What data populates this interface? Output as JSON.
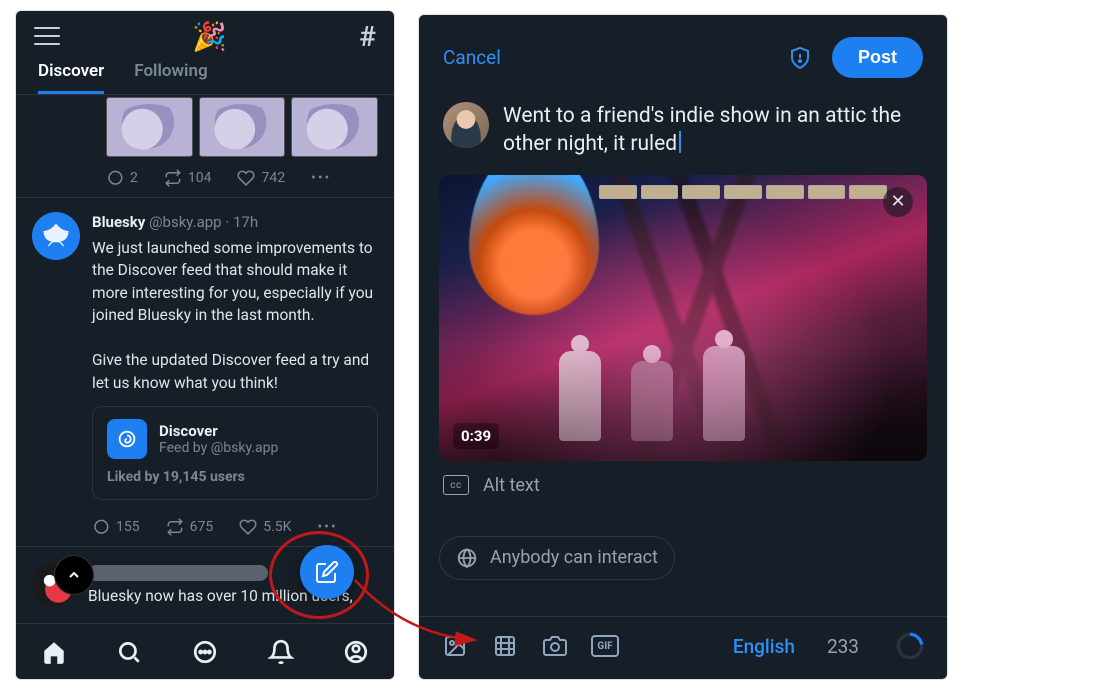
{
  "left": {
    "tabs": {
      "discover": "Discover",
      "following": "Following"
    },
    "first_actions": {
      "replies": "2",
      "reposts": "104",
      "likes": "742"
    },
    "bsky_post": {
      "display_name": "Bluesky",
      "handle": "@bsky.app",
      "time": "17h",
      "body_1": "We just launched some improvements to the Discover feed that should make it more interesting for you, especially if you joined Bluesky in the last month.",
      "body_2": "Give the updated Discover feed a try and let us know what you think!",
      "feed_card": {
        "title": "Discover",
        "subtitle": "Feed by @bsky.app",
        "likes": "Liked by 19,145 users"
      },
      "actions": {
        "replies": "155",
        "reposts": "675",
        "likes": "5.5K"
      }
    },
    "next_post_text": "Bluesky now has over 10 million users,"
  },
  "right": {
    "cancel": "Cancel",
    "post_btn": "Post",
    "compose_text": "Went to a friend's indie show in an attic the other night, it ruled",
    "media": {
      "duration": "0:39"
    },
    "alt_text_label": "Alt text",
    "interact_label": "Anybody can interact",
    "language": "English",
    "char_count": "233"
  }
}
